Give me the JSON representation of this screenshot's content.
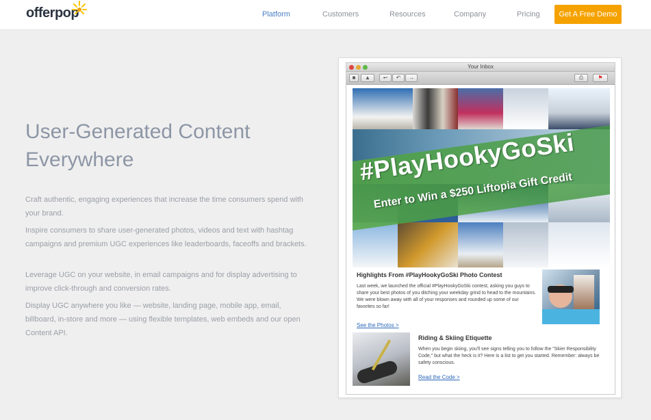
{
  "header": {
    "logo": "offerpop",
    "nav": [
      {
        "label": "Platform",
        "active": true
      },
      {
        "label": "Customers",
        "active": false
      },
      {
        "label": "Resources",
        "active": false
      },
      {
        "label": "Company",
        "active": false
      },
      {
        "label": "Pricing",
        "active": false
      }
    ],
    "cta": "Get A Free Demo"
  },
  "hero": {
    "headline_line1": "User-Generated Content",
    "headline_line2": "Everywhere",
    "paragraphs": [
      "Craft authentic, engaging experiences that increase the time consumers spend with your brand.",
      "Inspire consumers to share user-generated photos, videos and text with hashtag campaigns and premium UGC experiences like leaderboards, faceoffs and brackets.",
      "Leverage UGC on your website, in email campaigns and for display advertising to improve click-through and conversion rates.",
      "Display UGC anywhere you like — website, landing page, mobile app, email, billboard, in-store and more — using flexible templates, web embeds and our open Content API."
    ]
  },
  "mockup": {
    "window_title": "Your Inbox",
    "hashtag": "#PlayHookyGoSki",
    "promo": "Enter to Win a $250 Liftopia Gift Credit",
    "section1": {
      "title": "Highlights From #PlayHookyGoSki Photo Contest",
      "body": "Last week, we launched the official #PlayHookyGoSki contest, asking you guys to share your best photos of you ditching your weekday grind to head to the mountains. We were blown away with all of your responses and rounded up some of our favorites so far!",
      "link": "See the Photos >"
    },
    "section2": {
      "title": "Riding & Skiing Etiquette",
      "body": "When you begin skiing, you'll see signs telling you to follow the \"Skier Responsibility Code,\" but what the heck is it? Here is a list to get you started. Remember: always be safety conscious.",
      "link": "Read the Code >"
    }
  },
  "colors": {
    "accent_orange": "#f5a200",
    "nav_active": "#4b7ec4",
    "link_blue": "#2a66b7"
  }
}
